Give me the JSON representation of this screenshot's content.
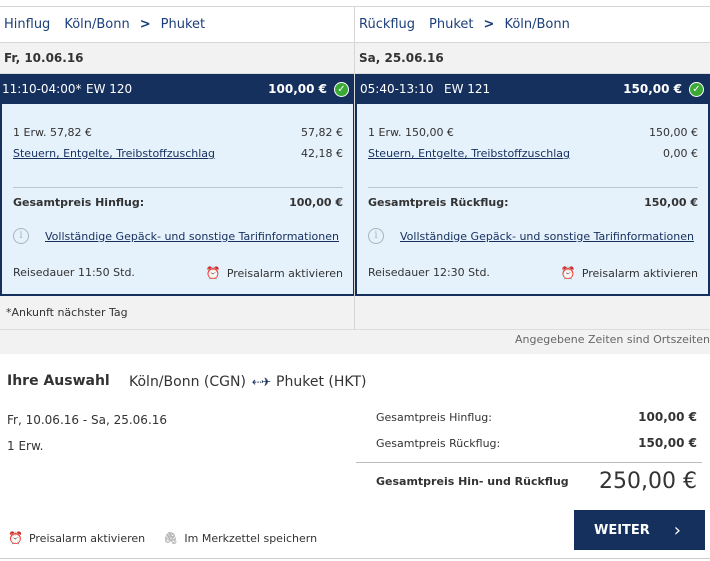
{
  "outbound": {
    "direction_label": "Hinflug",
    "from": "Köln/Bonn",
    "to": "Phuket",
    "date": "Fr, 10.06.16",
    "time": "11:10-04:00*",
    "flight_no": "EW 120",
    "price": "100,00 €",
    "pax_line": "1 Erw. 57,82 €",
    "pax_value": "57,82 €",
    "tax_label": "Steuern, Entgelte, Treibstoffzuschlag",
    "tax_value": "42,18 €",
    "total_label": "Gesamtpreis Hinflug:",
    "total_value": "100,00 €",
    "info_link": "Vollständige Gepäck- und sonstige Tarifinformationen",
    "duration": "Reisedauer 11:50  Std.",
    "alarm": "Preisalarm aktivieren"
  },
  "return": {
    "direction_label": "Rückflug",
    "from": "Phuket",
    "to": "Köln/Bonn",
    "date": "Sa, 25.06.16",
    "time": "05:40-13:10",
    "flight_no": "EW 121",
    "price": "150,00 €",
    "pax_line": "1 Erw. 150,00 €",
    "pax_value": "150,00 €",
    "tax_label": "Steuern, Entgelte, Treibstoffzuschlag",
    "tax_value": "0,00 €",
    "total_label": "Gesamtpreis Rückflug:",
    "total_value": "150,00 €",
    "info_link": "Vollständige Gepäck- und sonstige Tarifinformationen",
    "duration": "Reisedauer 12:30  Std.",
    "alarm": "Preisalarm aktivieren"
  },
  "note": "*Ankunft nächster Tag",
  "local_time_note": "Angegebene Zeiten sind Ortszeiten",
  "summary": {
    "title": "Ihre Auswahl",
    "from": "Köln/Bonn (CGN)",
    "to": "Phuket (HKT)",
    "dates": "Fr, 10.06.16 - Sa, 25.06.16",
    "pax": "1 Erw.",
    "out_label": "Gesamtpreis Hinflug:",
    "out_value": "100,00 €",
    "ret_label": "Gesamtpreis Rückflug:",
    "ret_value": "150,00 €",
    "total_label": "Gesamtpreis Hin- und Rückflug",
    "total_value": "250,00 €",
    "alarm": "Preisalarm aktivieren",
    "bookmark": "Im Merkzettel speichern",
    "next_button": "WEITER"
  },
  "icons": {
    "chevron": "›",
    "check": "✓",
    "info": "i",
    "alarm": "⏰",
    "plane": "⇠✈"
  },
  "colors": {
    "navy": "#16305e",
    "light_blue": "#e5f1fb",
    "check_green": "#3aa935"
  }
}
